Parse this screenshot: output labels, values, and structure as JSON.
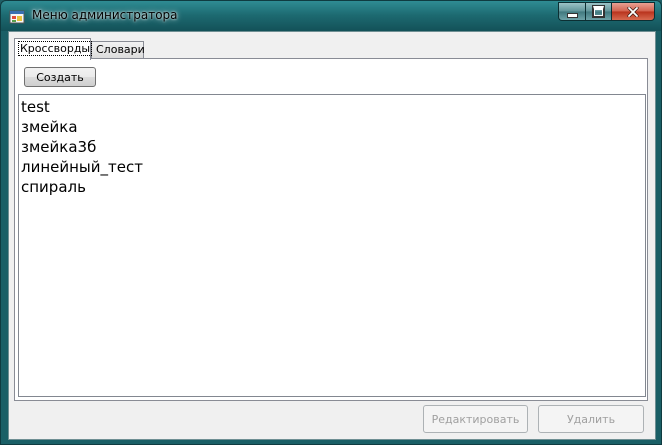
{
  "window": {
    "title": "Меню администратора"
  },
  "tabs": [
    {
      "label": "Кроссворды",
      "active": true
    },
    {
      "label": "Словари",
      "active": false
    }
  ],
  "crosswords_tab": {
    "create_label": "Создать",
    "items": [
      "test",
      "змейка",
      "змейка3б",
      "линейный_тест",
      "спираль"
    ]
  },
  "footer": {
    "edit_label": "Редактировать",
    "delete_label": "Удалить"
  }
}
